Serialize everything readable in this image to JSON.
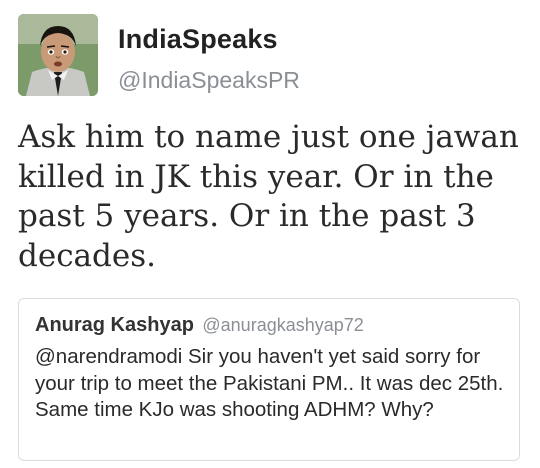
{
  "tweet": {
    "author": {
      "display_name": "IndiaSpeaks",
      "handle": "@IndiaSpeaksPR",
      "avatar_icon": "profile-photo-man-in-suit"
    },
    "text": "Ask him to name just one jawan killed in JK this year. Or in the past 5 years. Or in the past 3 decades.",
    "quoted": {
      "display_name": "Anurag Kashyap",
      "handle": "@anuragkashyap72",
      "text": "@narendramodi Sir you haven't yet said sorry for your trip to meet the Pakistani PM.. It was dec 25th. Same time KJo was shooting ADHM? Why?"
    }
  },
  "colors": {
    "text_primary": "#222222",
    "text_secondary": "#8a8f96",
    "card_border": "#d8dde2",
    "background": "#ffffff"
  }
}
